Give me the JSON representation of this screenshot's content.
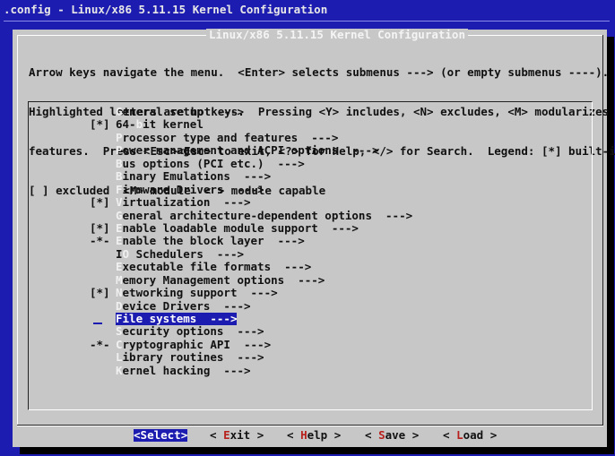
{
  "window_title": ".config - Linux/x86 5.11.15 Kernel Configuration",
  "dialog": {
    "title": "Linux/x86 5.11.15 Kernel Configuration",
    "help_lines": [
      "Arrow keys navigate the menu.  <Enter> selects submenus ---> (or empty submenus ----).",
      "Highlighted letters are hotkeys.  Pressing <Y> includes, <N> excludes, <M> modularizes",
      "features.  Press <Esc><Esc> to exit, <?> for Help, </> for Search.  Legend: [*] built-in",
      "[ ] excluded  <M> module  < > module capable"
    ]
  },
  "menu": {
    "items": [
      {
        "prefix": "",
        "hotkey": "G",
        "rest": "eneral setup  --->",
        "selected": false
      },
      {
        "prefix": "[*]",
        "pre": "64-",
        "hotkey": "b",
        "rest": "it kernel",
        "selected": false
      },
      {
        "prefix": "",
        "hotkey": "P",
        "rest": "rocessor type and features  --->",
        "selected": false
      },
      {
        "prefix": "",
        "hotkey": "P",
        "rest": "ower management and ACPI options  --->",
        "selected": false
      },
      {
        "prefix": "",
        "hotkey": "B",
        "rest": "us options (PCI etc.)  --->",
        "selected": false
      },
      {
        "prefix": "",
        "hotkey": "B",
        "rest": "inary Emulations  --->",
        "selected": false
      },
      {
        "prefix": "",
        "hotkey": "F",
        "rest": "irmware Drivers  --->",
        "selected": false
      },
      {
        "prefix": "[*]",
        "hotkey": "V",
        "rest": "irtualization  --->",
        "selected": false
      },
      {
        "prefix": "",
        "hotkey": "G",
        "rest": "eneral architecture-dependent options  --->",
        "selected": false
      },
      {
        "prefix": "[*]",
        "hotkey": "E",
        "rest": "nable loadable module support  --->",
        "selected": false
      },
      {
        "prefix": "-*-",
        "hotkey": "E",
        "rest": "nable the block layer  --->",
        "selected": false
      },
      {
        "prefix": "",
        "pre": "I",
        "hotkey": "O",
        "rest": " Schedulers  --->",
        "selected": false
      },
      {
        "prefix": "",
        "hotkey": "E",
        "rest": "xecutable file formats  --->",
        "selected": false
      },
      {
        "prefix": "",
        "hotkey": "M",
        "rest": "emory Management options  --->",
        "selected": false
      },
      {
        "prefix": "[*]",
        "hotkey": "N",
        "rest": "etworking support  --->",
        "selected": false
      },
      {
        "prefix": "",
        "hotkey": "D",
        "rest": "evice Drivers  --->",
        "selected": false
      },
      {
        "prefix": "",
        "hotkey": "F",
        "rest": "ile systems  --->",
        "selected": true
      },
      {
        "prefix": "",
        "hotkey": "S",
        "rest": "ecurity options  --->",
        "selected": false
      },
      {
        "prefix": "-*-",
        "hotkey": "C",
        "rest": "ryptographic API  --->",
        "selected": false
      },
      {
        "prefix": "",
        "hotkey": "L",
        "rest": "ibrary routines  --->",
        "selected": false
      },
      {
        "prefix": "",
        "hotkey": "K",
        "rest": "ernel hacking  --->",
        "selected": false
      }
    ]
  },
  "buttons": [
    {
      "open": "<",
      "hotkey": "S",
      "rest": "elect",
      "close": ">",
      "active": true
    },
    {
      "open": "< ",
      "hotkey": "E",
      "rest": "xit",
      "close": " >",
      "active": false
    },
    {
      "open": "< ",
      "hotkey": "H",
      "rest": "elp",
      "close": " >",
      "active": false
    },
    {
      "open": "< ",
      "hotkey": "S",
      "rest": "ave",
      "close": " >",
      "active": false
    },
    {
      "open": "< ",
      "hotkey": "L",
      "rest": "oad",
      "close": " >",
      "active": false
    }
  ],
  "colors": {
    "background": "#1c1cb0",
    "dialog": "#c7c7c7",
    "hotkey": "#f0f0f0",
    "button_hotkey": "#b8201c",
    "selection": "#1c1cb0"
  }
}
